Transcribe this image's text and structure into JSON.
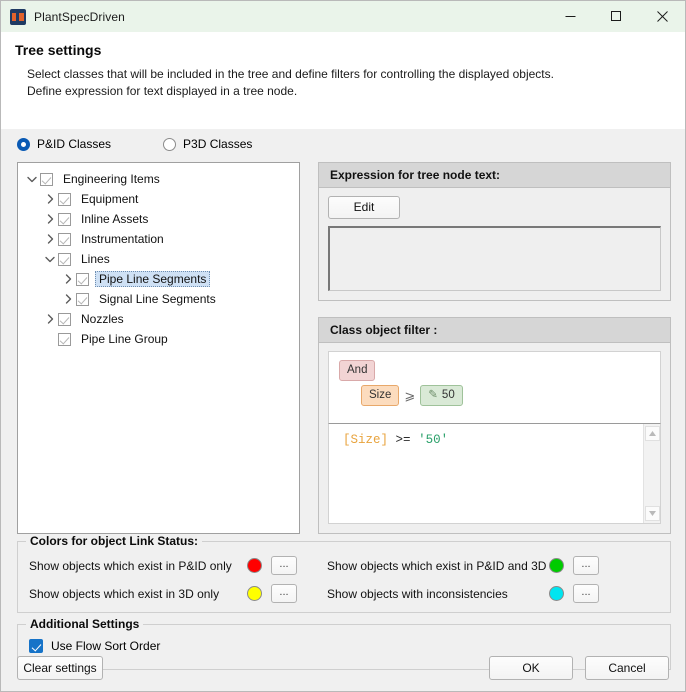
{
  "window": {
    "title": "PlantSpecDriven",
    "icon": "plant-app-icon",
    "controls": {
      "minimize": "minimize-icon",
      "maximize": "maximize-icon",
      "close": "close-icon"
    }
  },
  "header": {
    "title": "Tree settings",
    "description_line1": "Select classes that will be included in the tree and define filters for controlling the displayed objects.",
    "description_line2": "Define expression for text displayed in a tree node."
  },
  "class_mode": {
    "options": [
      {
        "label": "P&ID Classes",
        "selected": true
      },
      {
        "label": "P3D Classes",
        "selected": false
      }
    ]
  },
  "tree": {
    "nodes": [
      {
        "label": "Engineering Items",
        "indent": 0,
        "expander": "down",
        "checked": true,
        "selected": false
      },
      {
        "label": "Equipment",
        "indent": 1,
        "expander": "right",
        "checked": true,
        "selected": false
      },
      {
        "label": "Inline Assets",
        "indent": 1,
        "expander": "right",
        "checked": true,
        "selected": false
      },
      {
        "label": "Instrumentation",
        "indent": 1,
        "expander": "right",
        "checked": true,
        "selected": false
      },
      {
        "label": "Lines",
        "indent": 1,
        "expander": "down",
        "checked": true,
        "selected": false
      },
      {
        "label": "Pipe Line Segments",
        "indent": 2,
        "expander": "right",
        "checked": true,
        "selected": true
      },
      {
        "label": "Signal Line Segments",
        "indent": 2,
        "expander": "right",
        "checked": true,
        "selected": false
      },
      {
        "label": "Nozzles",
        "indent": 1,
        "expander": "right",
        "checked": true,
        "selected": false
      },
      {
        "label": "Pipe Line Group",
        "indent": 1,
        "expander": "none",
        "checked": true,
        "selected": false
      }
    ]
  },
  "expression_group": {
    "header": "Expression for tree node text:",
    "edit_label": "Edit",
    "expression_value": ""
  },
  "filter_group": {
    "header": "Class object filter :",
    "tokens": {
      "logic": "And",
      "field": "Size",
      "operator": "⩾",
      "value": "50",
      "value_icon": "pencil-icon"
    },
    "code": {
      "field": "[Size]",
      "operator": ">=",
      "value": "'50'"
    },
    "scrollbar": {
      "up": "scroll-up-arrow-icon",
      "down": "scroll-down-arrow-icon"
    }
  },
  "colors_group": {
    "legend": "Colors for object Link Status:",
    "items": [
      {
        "label": "Show objects which exist in P&ID only",
        "color": "#FF0000",
        "button": "..."
      },
      {
        "label": "Show objects which exist in P&ID and 3D",
        "color": "#00CC00",
        "button": "..."
      },
      {
        "label": "Show objects which exist in 3D only",
        "color": "#FFFF00",
        "button": "..."
      },
      {
        "label": "Show objects with inconsistencies",
        "color": "#00E5F0",
        "button": "..."
      }
    ]
  },
  "additional_settings": {
    "legend": "Additional Settings",
    "flow_sort": {
      "label": "Use Flow Sort Order",
      "checked": true
    }
  },
  "footer": {
    "clear_label": "Clear settings",
    "ok_label": "OK",
    "cancel_label": "Cancel"
  }
}
